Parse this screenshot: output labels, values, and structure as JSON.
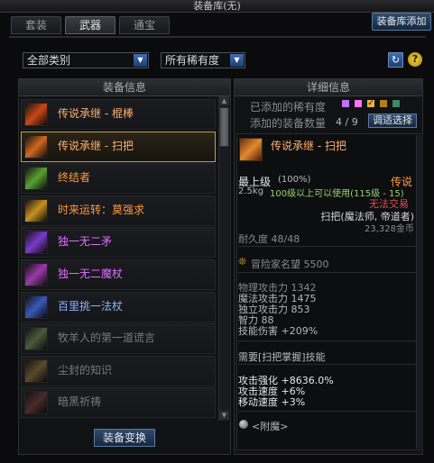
{
  "window": {
    "title": "装备库(无)"
  },
  "tabs": [
    {
      "label": "套装",
      "active": false
    },
    {
      "label": "武器",
      "active": true
    },
    {
      "label": "通宝",
      "active": false
    }
  ],
  "storage_add_button": "装备库添加",
  "filters": {
    "category": "全部类别",
    "rarity": "所有稀有度"
  },
  "left_panel": {
    "header": "装备信息",
    "items": [
      {
        "label": "传说承继 - 棍棒",
        "color": "#ffb070",
        "icon": "staff-weapon-icon",
        "icon_color": "#c84818",
        "selected": false
      },
      {
        "label": "传说承继 - 扫把",
        "color": "#ffb070",
        "icon": "broom-weapon-icon",
        "icon_color": "#d06820",
        "selected": true
      },
      {
        "label": "终结者",
        "color": "#ff9a3c",
        "icon": "terminator-weapon-icon",
        "icon_color": "#5aa030",
        "selected": false
      },
      {
        "label": "时来运转：莫强求",
        "color": "#ff9a3c",
        "icon": "fortune-weapon-icon",
        "icon_color": "#c89020",
        "selected": false
      },
      {
        "label": "独一无二矛",
        "color": "#e070ff",
        "icon": "spear-weapon-icon",
        "icon_color": "#7a3ac8",
        "selected": false
      },
      {
        "label": "独一无二魔杖",
        "color": "#e070ff",
        "icon": "wand-weapon-icon",
        "icon_color": "#9a3aa8",
        "selected": false
      },
      {
        "label": "百里挑一法杖",
        "color": "#8ab4ff",
        "icon": "magic-staff-icon",
        "icon_color": "#3a58b8",
        "selected": false
      },
      {
        "label": "牧羊人的第一道谎言",
        "color": "#7a7a7a",
        "icon": "shepherd-weapon-icon",
        "icon_color": "#4a5a3a",
        "selected": false
      },
      {
        "label": "尘封的知识",
        "color": "#7a7a7a",
        "icon": "dusty-knowledge-icon",
        "icon_color": "#5a4a2a",
        "selected": false
      },
      {
        "label": "暗黑祈祷",
        "color": "#7a7a7a",
        "icon": "dark-prayer-icon",
        "icon_color": "#4a2a2a",
        "selected": false
      }
    ],
    "swap_button": "装备变换"
  },
  "right_panel": {
    "header": "详细信息",
    "added_rarity_label": "已添加的稀有度",
    "rarity_colors": [
      "#c070ff",
      "#ff70ff",
      "#e8b048",
      "#b08018",
      "#3a8a6a"
    ],
    "added_count_label": "添加的装备数量",
    "added_count_value": "4 / 9",
    "add_select_button": "调适选择",
    "item": {
      "name": "传说承继 - 扫把",
      "grade": "最上级",
      "grade_pct": "(100%)",
      "rarity": "传说",
      "weight": "2.5kg",
      "level_req": "100级以上可以使用(115级 - 15)",
      "trade": "无法交易",
      "type": "扫把(魔法师, 帝道者)",
      "price": "23,328金币",
      "durability": "耐久度 48/48",
      "adventurer_fame": "冒险家名望 5500",
      "stats": [
        "物理攻击力 1342",
        "魔法攻击力 1475",
        "独立攻击力 853",
        "智力 88",
        "技能伤害 +209%"
      ],
      "skill_req": "需要[扫把掌握]技能",
      "bonuses": [
        "攻击强化 +8636.0%",
        "攻击速度 +6%",
        "移动速度 +3%"
      ],
      "enchant": "<附魔>"
    }
  }
}
